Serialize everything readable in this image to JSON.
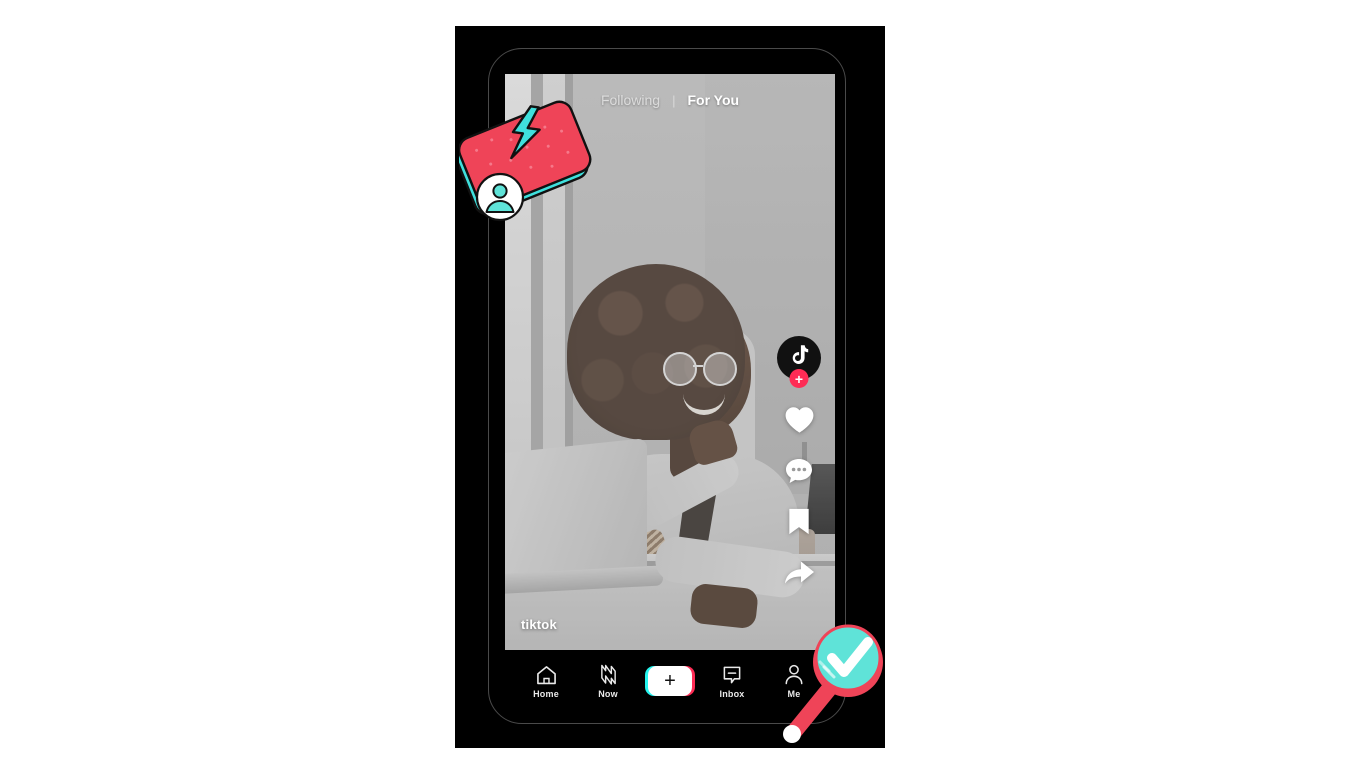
{
  "app": {
    "name": "TikTok",
    "platform": "mobile-phone-mockup",
    "background_color": "#ffffff",
    "device_color": "#000000"
  },
  "feed": {
    "tabs": [
      {
        "id": "following",
        "label": "Following",
        "active": false
      },
      {
        "id": "for_you",
        "label": "For You",
        "active": true
      }
    ],
    "tab_divider": "|",
    "watermark": "tiktok",
    "video_description": "Grayscale photo of a smiling woman with an afro and round glasses sitting at a desk with a laptop"
  },
  "action_rail": {
    "avatar": {
      "name": "author-avatar",
      "icon": "tiktok-note-icon",
      "follow_badge_label": "+"
    },
    "items": [
      {
        "id": "like",
        "icon": "heart-icon",
        "label": ""
      },
      {
        "id": "comment",
        "icon": "comment-bubble-icon",
        "label": ""
      },
      {
        "id": "bookmark",
        "icon": "bookmark-icon",
        "label": ""
      },
      {
        "id": "share",
        "icon": "share-arrow-icon",
        "label": ""
      }
    ]
  },
  "bottom_nav": {
    "items": [
      {
        "id": "home",
        "label": "Home",
        "icon": "home-icon"
      },
      {
        "id": "now",
        "label": "Now",
        "icon": "now-flash-icon"
      },
      {
        "id": "create",
        "label": "+",
        "icon": "plus-icon"
      },
      {
        "id": "inbox",
        "label": "Inbox",
        "icon": "inbox-message-icon"
      },
      {
        "id": "me",
        "label": "Me",
        "icon": "person-icon"
      }
    ]
  },
  "decorations": {
    "promo_card": {
      "name": "tilted-phone-card",
      "icon": "lightning-bolt-icon",
      "avatar_icon": "person-avatar-icon",
      "colors": {
        "card": "#ef4458",
        "edge": "#3fe0dd",
        "outline": "#111111"
      }
    },
    "magnifier": {
      "name": "magnifier-checkmark",
      "icon": "magnifying-glass-icon",
      "inner_icon": "check-icon",
      "colors": {
        "lens": "#5fe3d8",
        "rim": "#ef4458",
        "handle": "#ef4458",
        "check": "#ffffff"
      }
    }
  },
  "colors": {
    "tiktok_red": "#fe2c55",
    "tiktok_cyan": "#25f4ee",
    "accent_pink": "#ef4458",
    "accent_teal": "#5fe3d8",
    "text_white": "#ffffff",
    "text_muted": "rgba(255,255,255,0.62)"
  }
}
